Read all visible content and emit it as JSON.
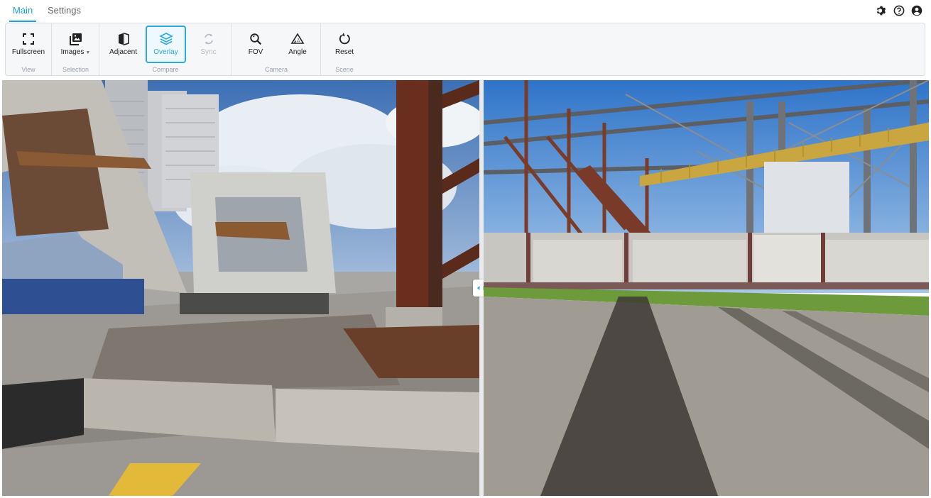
{
  "tabs": [
    {
      "label": "Main",
      "active": true
    },
    {
      "label": "Settings",
      "active": false
    }
  ],
  "top_icons": [
    "gear-icon",
    "help-icon",
    "account-icon"
  ],
  "toolbar": {
    "groups": [
      {
        "label": "View",
        "buttons": [
          {
            "label": "Fullscreen",
            "icon": "fullscreen-icon"
          }
        ]
      },
      {
        "label": "Selection",
        "buttons": [
          {
            "label": "Images",
            "icon": "images-icon",
            "has_dropdown": true
          }
        ]
      },
      {
        "label": "Compare",
        "buttons": [
          {
            "label": "Adjacent",
            "icon": "adjacent-icon"
          },
          {
            "label": "Overlay",
            "icon": "layers-icon",
            "active": true
          },
          {
            "label": "Sync",
            "icon": "sync-icon",
            "disabled": true
          }
        ]
      },
      {
        "label": "Camera",
        "buttons": [
          {
            "label": "FOV",
            "icon": "zoom-icon"
          },
          {
            "label": "Angle",
            "icon": "angle-icon"
          }
        ]
      },
      {
        "label": "Scene",
        "buttons": [
          {
            "label": "Reset",
            "icon": "reset-icon"
          }
        ]
      }
    ]
  },
  "viewer": {
    "left_image": "construction-site-panorama",
    "right_image": "industrial-yard-panorama",
    "divider_handle_icon": "split-arrows-icon"
  },
  "colors": {
    "accent": "#29a9df",
    "tab_active": "#1aa2d6"
  }
}
